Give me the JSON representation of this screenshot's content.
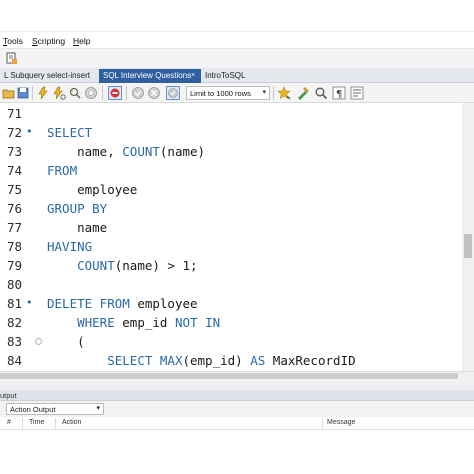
{
  "menu": [
    "Tools",
    "Scripting",
    "Help"
  ],
  "tabs": [
    {
      "label": "L Subquery select-insert",
      "active": false
    },
    {
      "label": "SQL Interview Questions",
      "active": true
    },
    {
      "label": "IntroToSQL",
      "active": false
    }
  ],
  "tab_close_glyph": "×",
  "toolbar": {
    "limit_label": "Limit to 1000 rows",
    "icons": [
      "open-file-icon",
      "save-icon",
      "execute-icon",
      "execute-statement-icon",
      "explain-icon",
      "stop-icon",
      "toggle-error-stop-icon",
      "commit-icon",
      "rollback-icon",
      "autocommit-icon",
      "beautify-icon",
      "find-icon",
      "invisible-chars-icon",
      "wrap-icon"
    ]
  },
  "editor": {
    "lines": [
      {
        "n": "71",
        "marker": "",
        "fold": false,
        "html": ""
      },
      {
        "n": "72",
        "marker": "•",
        "fold": false,
        "html": "<span class=\"kw\">SELECT</span>"
      },
      {
        "n": "73",
        "marker": "",
        "fold": false,
        "html": "    name, <span class=\"fn\">COUNT</span>(name)"
      },
      {
        "n": "74",
        "marker": "",
        "fold": false,
        "html": "<span class=\"kw\">FROM</span>"
      },
      {
        "n": "75",
        "marker": "",
        "fold": false,
        "html": "    employee"
      },
      {
        "n": "76",
        "marker": "",
        "fold": false,
        "html": "<span class=\"kw\">GROUP BY</span>"
      },
      {
        "n": "77",
        "marker": "",
        "fold": false,
        "html": "    name"
      },
      {
        "n": "78",
        "marker": "",
        "fold": false,
        "html": "<span class=\"kw\">HAVING</span>"
      },
      {
        "n": "79",
        "marker": "",
        "fold": false,
        "html": "    <span class=\"fn\">COUNT</span>(name) &gt; 1;"
      },
      {
        "n": "80",
        "marker": "",
        "fold": false,
        "html": ""
      },
      {
        "n": "81",
        "marker": "•",
        "fold": false,
        "html": "<span class=\"kw\">DELETE FROM</span> employee"
      },
      {
        "n": "82",
        "marker": "",
        "fold": false,
        "html": "    <span class=\"kw\">WHERE</span> emp_id <span class=\"kw\">NOT IN</span>"
      },
      {
        "n": "83",
        "marker": "",
        "fold": true,
        "html": "    ("
      },
      {
        "n": "84",
        "marker": "",
        "fold": false,
        "html": "        <span class=\"kw\">SELECT</span> <span class=\"fn\">MAX</span>(emp_id) <span class=\"kw\">AS</span> MaxRecordID"
      }
    ]
  },
  "output": {
    "title": "utput",
    "selector": "Action Output",
    "columns": [
      "#",
      "Time",
      "Action",
      "Message"
    ]
  },
  "colors": {
    "keyword": "#2a69a8",
    "active_tab": "#2f5f9e",
    "tab_bar": "#e4e7ec"
  }
}
